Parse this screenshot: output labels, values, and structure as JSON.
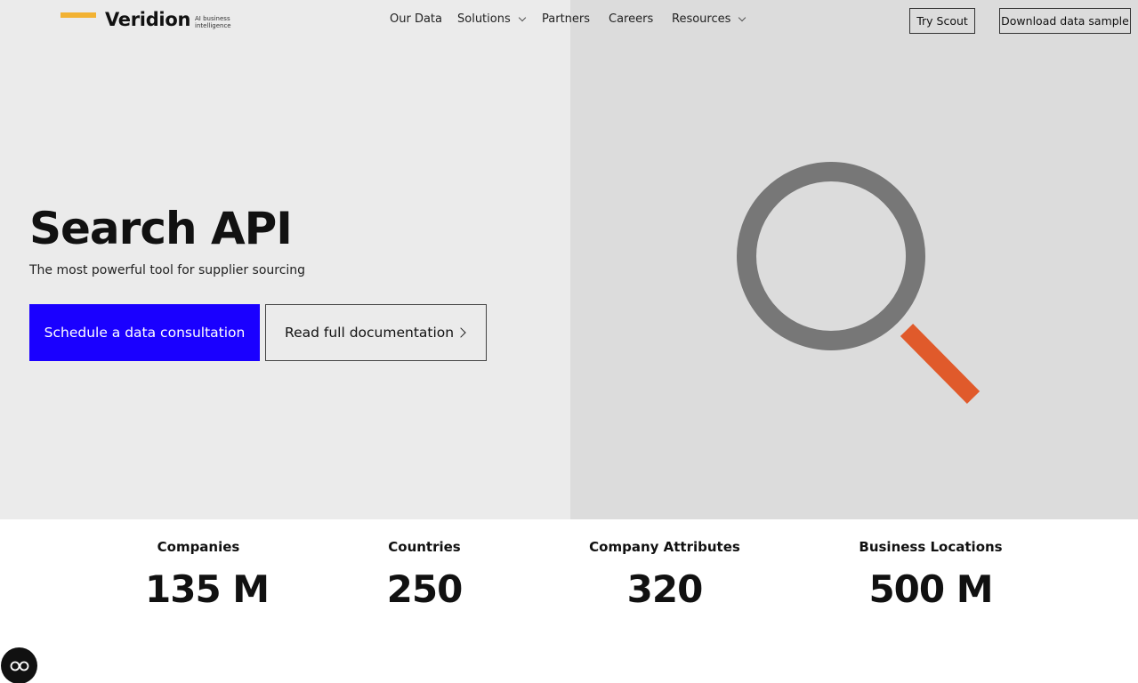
{
  "brand": {
    "name": "Veridion",
    "tagline": "AI business intelligence",
    "accent_color": "#f2b233"
  },
  "nav": {
    "items": [
      {
        "label": "Our Data",
        "has_dropdown": false
      },
      {
        "label": "Solutions",
        "has_dropdown": true
      },
      {
        "label": "Partners",
        "has_dropdown": false
      },
      {
        "label": "Careers",
        "has_dropdown": false
      },
      {
        "label": "Resources",
        "has_dropdown": true
      }
    ],
    "try_scout": "Try Scout",
    "download_sample": "Download data sample"
  },
  "hero": {
    "title": "Search API",
    "subtitle": "The most powerful tool for supplier sourcing",
    "primary_cta": "Schedule a data consultation",
    "secondary_cta": "Read full documentation",
    "primary_color": "#1a00ff",
    "illustration": "magnifying-glass",
    "illustration_handle_color": "#e05a2b"
  },
  "stats": [
    {
      "label": "Companies",
      "value": "135 M"
    },
    {
      "label": "Countries",
      "value": "250"
    },
    {
      "label": "Company Attributes",
      "value": "320"
    },
    {
      "label": "Business Locations",
      "value": "500 M"
    }
  ],
  "chat_widget": {
    "icon": "chat-glasses-icon"
  }
}
